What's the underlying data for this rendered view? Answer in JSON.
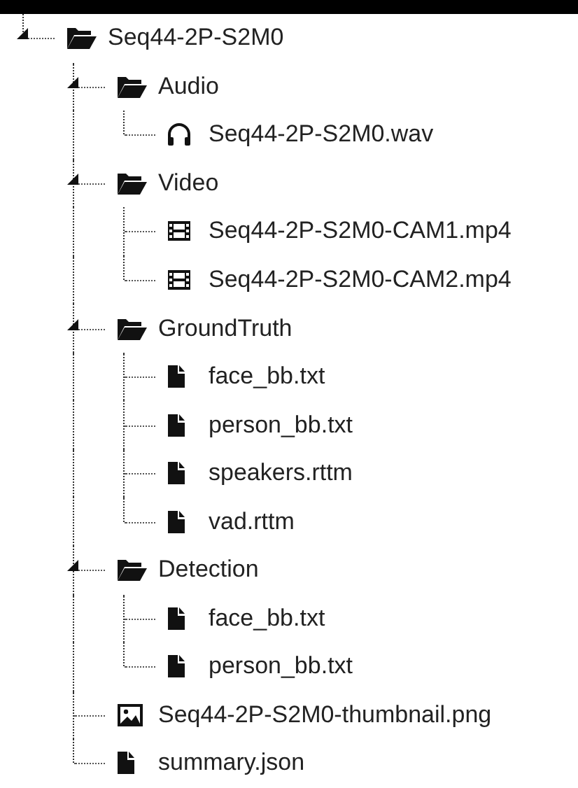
{
  "tree": [
    {
      "name": "Seq44-2P-S2M0",
      "kind": "folder",
      "expanded": true,
      "children": [
        {
          "name": "Audio",
          "kind": "folder",
          "expanded": true,
          "children": [
            {
              "name": "Seq44-2P-S2M0.wav",
              "kind": "audio"
            }
          ]
        },
        {
          "name": "Video",
          "kind": "folder",
          "expanded": true,
          "children": [
            {
              "name": "Seq44-2P-S2M0-CAM1.mp4",
              "kind": "video"
            },
            {
              "name": "Seq44-2P-S2M0-CAM2.mp4",
              "kind": "video"
            }
          ]
        },
        {
          "name": "GroundTruth",
          "kind": "folder",
          "expanded": true,
          "children": [
            {
              "name": "face_bb.txt",
              "kind": "file"
            },
            {
              "name": "person_bb.txt",
              "kind": "file"
            },
            {
              "name": "speakers.rttm",
              "kind": "file"
            },
            {
              "name": "vad.rttm",
              "kind": "file"
            }
          ]
        },
        {
          "name": "Detection",
          "kind": "folder",
          "expanded": true,
          "children": [
            {
              "name": "face_bb.txt",
              "kind": "file"
            },
            {
              "name": "person_bb.txt",
              "kind": "file"
            }
          ]
        },
        {
          "name": "Seq44-2P-S2M0-thumbnail.png",
          "kind": "image"
        },
        {
          "name": "summary.json",
          "kind": "file"
        }
      ]
    }
  ]
}
